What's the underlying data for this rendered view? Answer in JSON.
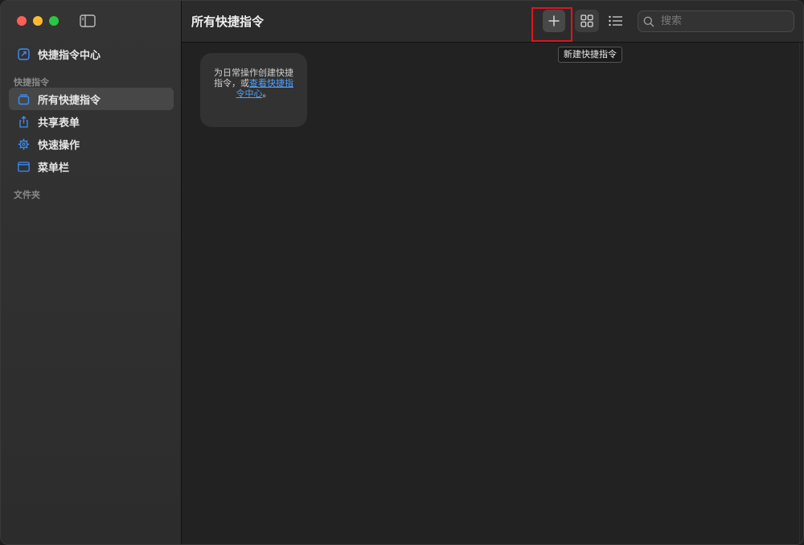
{
  "window": {
    "title": "所有快捷指令"
  },
  "sidebar": {
    "gallery_label": "快捷指令中心",
    "section_shortcuts": "快捷指令",
    "items": [
      {
        "label": "所有快捷指令",
        "icon": "shortcuts-stack-icon",
        "selected": true
      },
      {
        "label": "共享表单",
        "icon": "share-icon",
        "selected": false
      },
      {
        "label": "快速操作",
        "icon": "gear-icon",
        "selected": false
      },
      {
        "label": "菜单栏",
        "icon": "menubar-icon",
        "selected": false
      }
    ],
    "section_folders": "文件夹"
  },
  "toolbar": {
    "add_tooltip": "新建快捷指令",
    "search_placeholder": "搜索"
  },
  "main": {
    "empty_text_before": "为日常操作创建快捷指令，或",
    "empty_link": "查看快捷指令中心",
    "empty_text_after": "。"
  },
  "colors": {
    "accent": "#4ea1ff",
    "highlight_box": "#e0141e",
    "close": "#ff5f57",
    "minimize": "#febc2e",
    "zoom": "#28c840"
  }
}
